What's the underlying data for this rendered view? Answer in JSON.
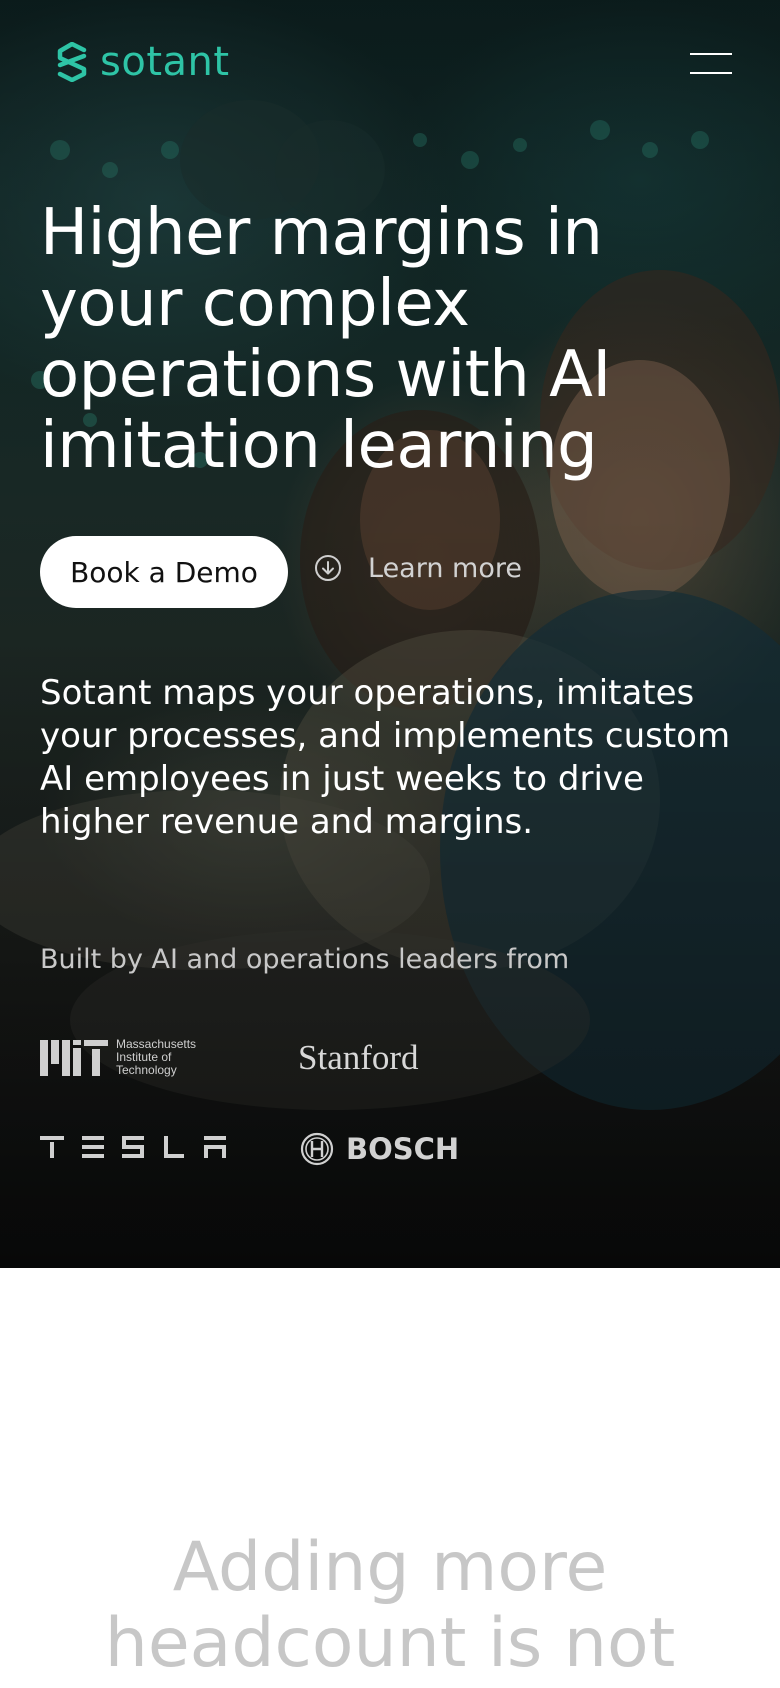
{
  "brand": {
    "name": "sotant",
    "accent_color": "#2ec4a6"
  },
  "nav": {
    "menu_icon": "hamburger-menu-icon"
  },
  "hero": {
    "headline": "Higher margins in your complex operations with AI imitation learning",
    "cta_label": "Book a Demo",
    "learn_more_label": "Learn more",
    "learn_more_icon": "arrow-down-circle-icon",
    "description": "Sotant maps your operations, imitates your processes, and implements custom AI employees in just weeks to drive higher revenue and margins.",
    "built_by": "Built by AI and operations leaders from",
    "logos": [
      {
        "name": "Massachusetts Institute of Technology",
        "icon": "mit-logo"
      },
      {
        "name": "Stanford",
        "icon": "stanford-logo"
      },
      {
        "name": "TESLA",
        "icon": "tesla-logo"
      },
      {
        "name": "BOSCH",
        "icon": "bosch-logo"
      }
    ]
  },
  "next_section": {
    "heading": "Adding more headcount is not"
  }
}
